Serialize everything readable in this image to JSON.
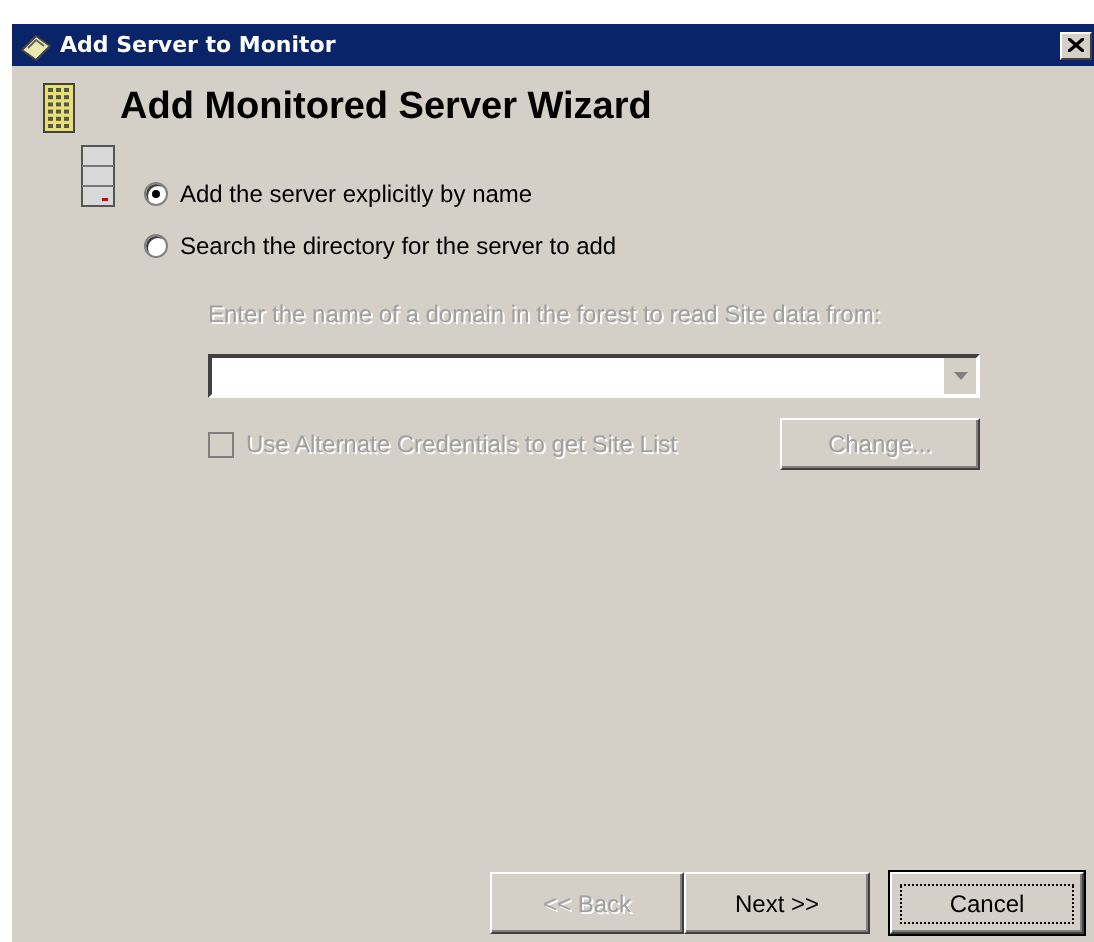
{
  "window": {
    "title": "Add Server to Monitor"
  },
  "heading": "Add Monitored Server Wizard",
  "options": [
    {
      "label": "Add the server explicitly by name",
      "selected": true
    },
    {
      "label": "Search the directory for the server to add",
      "selected": false
    }
  ],
  "domain_prompt": {
    "text": "Enter the name of a domain in the forest to read Site data from:",
    "disabled": true
  },
  "alt_credentials": {
    "label": "Use Alternate Credentials to get Site List",
    "checked": false,
    "disabled": true
  },
  "change_button": {
    "label": "Change...",
    "disabled": true
  },
  "buttons": [
    {
      "label": "<< Back",
      "disabled": true,
      "default": false
    },
    {
      "label": "Next >>",
      "disabled": false,
      "default": false
    },
    {
      "label": "Cancel",
      "disabled": false,
      "default": true
    }
  ]
}
